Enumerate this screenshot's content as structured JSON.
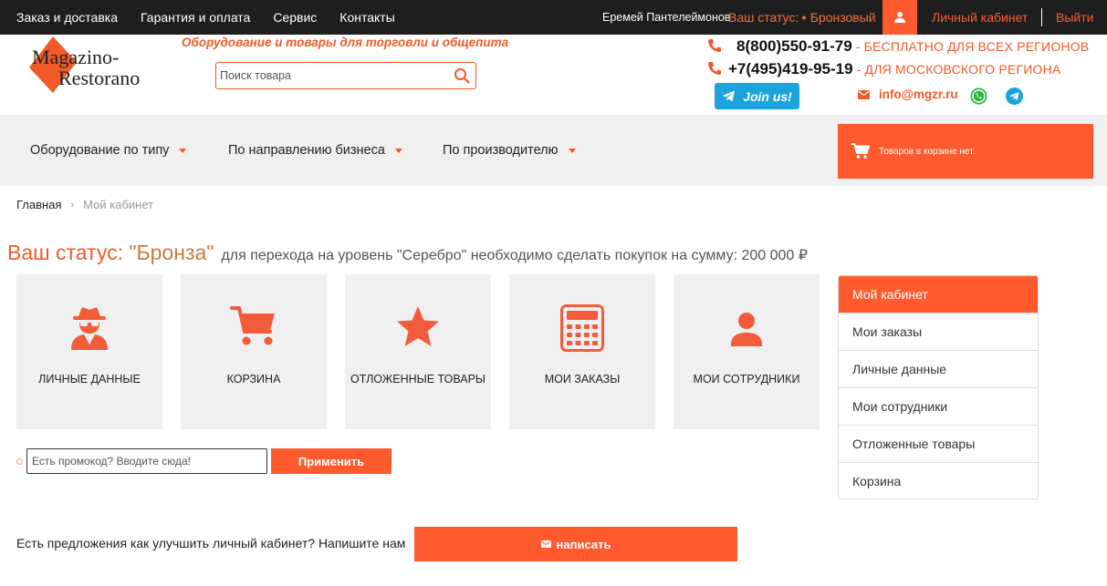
{
  "topbar": {
    "nav": [
      "Заказ и доставка",
      "Гарантия и оплата",
      "Сервис",
      "Контакты"
    ],
    "user_name": "Еремей Пантелеймонов",
    "status_label": "Ваш статус:",
    "status_value": "Бронзовый",
    "cabinet": "Личный кабинет",
    "logout": "Выйти"
  },
  "header": {
    "logo_line1": "Magazino-",
    "logo_line2": "Restorano",
    "tagline": "Оборудование и товары для торговли и общепита",
    "search_placeholder": "Поиск товара",
    "phone1": {
      "number": "8(800)550-91-79",
      "desc": "- БЕСПЛАТНО ДЛЯ ВСЕХ РЕГИОНОВ"
    },
    "phone2": {
      "number": "+7(495)419-95-19",
      "desc": "- ДЛЯ МОСКОВСКОГО РЕГИОНА"
    },
    "join": "Join us!",
    "email": "info@mgzr.ru"
  },
  "menu": {
    "items": [
      "Оборудование по типу",
      "По направлению бизнеса",
      "По производителю"
    ],
    "cart": "Товаров в корзине нет."
  },
  "breadcrumb": {
    "home": "Главная",
    "current": "Мой кабинет"
  },
  "status": {
    "label": "Ваш статус:",
    "level": "\"Бронза\"",
    "note": "для перехода на уровень \"Серебро\" необходимо сделать покупок на сумму: 200 000 ₽"
  },
  "tiles": [
    {
      "label": "ЛИЧНЫЕ ДАННЫЕ",
      "icon": "spy-icon"
    },
    {
      "label": "КОРЗИНА",
      "icon": "cart-icon"
    },
    {
      "label": "ОТЛОЖЕННЫЕ ТОВАРЫ",
      "icon": "star-icon"
    },
    {
      "label": "МОИ ЗАКАЗЫ",
      "icon": "calculator-icon"
    },
    {
      "label": "МОИ СОТРУДНИКИ",
      "icon": "user-icon"
    }
  ],
  "sidebar": {
    "items": [
      "Мой кабинет",
      "Мои заказы",
      "Личные данные",
      "Мои сотрудники",
      "Отложенные товары",
      "Корзина"
    ]
  },
  "promo": {
    "placeholder": "Есть промокод? Вводите сюда!",
    "button": "Применить"
  },
  "feedback": {
    "text": "Есть предложения как улучшить личный кабинет? Напишите нам",
    "button": "написать"
  },
  "colors": {
    "accent": "#ff5a2e",
    "topbar": "#1e1e1e",
    "panel": "#f0f0f0",
    "telegram": "#1ba3dd"
  }
}
